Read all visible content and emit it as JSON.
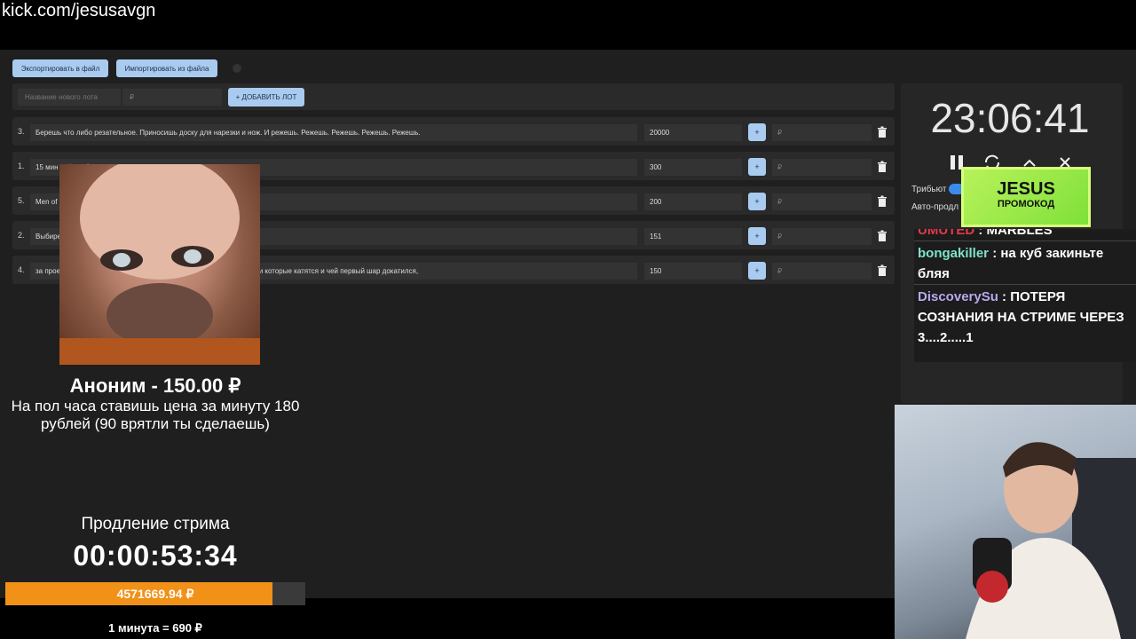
{
  "browser": {
    "url": "kick.com/jesusavgn"
  },
  "toolbar": {
    "export_label": "Экспортировать в файл",
    "import_label": "Импортировать из файла"
  },
  "new_lot": {
    "name_placeholder": "Название нового лота",
    "amount_placeholder": "₽",
    "add_label": "+ ДОБАВИТЬ ЛОТ"
  },
  "lots": [
    {
      "num": "3.",
      "name": "Берешь что либо резательное. Приносишь доску для нарезки и нож. И режешь. Режешь. Режешь. Режешь. Режешь.",
      "amount": "20000",
      "plus": "+",
      "rub": "₽"
    },
    {
      "num": "1.",
      "name": "15 мин                                  сайт либо",
      "amount": "300",
      "plus": "+",
      "rub": "₽"
    },
    {
      "num": "5.",
      "name": "Men of",
      "amount": "200",
      "plus": "+",
      "rub": "₽"
    },
    {
      "num": "2.",
      "name": "Выбире                                                                      ску)",
      "amount": "151",
      "plus": "+",
      "rub": "₽"
    },
    {
      "num": "4.",
      "name": "за прое                                                         чат писали что бы присоединиться к игре, а игра это шарики которые катятся и чей первый шар докатился,",
      "amount": "150",
      "plus": "+",
      "rub": "₽"
    }
  ],
  "timer": {
    "clock": "23:06:41",
    "tribute_label": "Трибьют",
    "auto_label": "Авто-продл"
  },
  "promo": {
    "line1": "JESUS",
    "line2": "ПРОМОКОД"
  },
  "chat": [
    {
      "user": "UMUTED",
      "user_color": "#e5394b",
      "text": " : MARBLES"
    },
    {
      "user": "bongakiller",
      "user_color": "#7fe3c8",
      "text": " : на куб закиньте бляя"
    },
    {
      "user": "DiscoverySu",
      "user_color": "#b9a8f0",
      "text": " : ПОТЕРЯ СОЗНАНИЯ НА СТРИМЕ ЧЕРЕЗ 3....2.....1"
    }
  ],
  "donation": {
    "name": "Аноним - 150.00 ₽",
    "message": "На пол часа ставишь цена за минуту 180 рублей (90 врятли ты сделаешь)"
  },
  "extension": {
    "label": "Продление стрима",
    "time": "00:00:53:34",
    "progress_text": "4571669.94 ₽",
    "progress_fraction": 0.89,
    "progress_color": "#f29117",
    "rate": "1 минута = 690 ₽"
  },
  "icons": [
    "trash-icon",
    "pause-icon",
    "refresh-icon",
    "chevron-up-icon",
    "close-icon"
  ]
}
